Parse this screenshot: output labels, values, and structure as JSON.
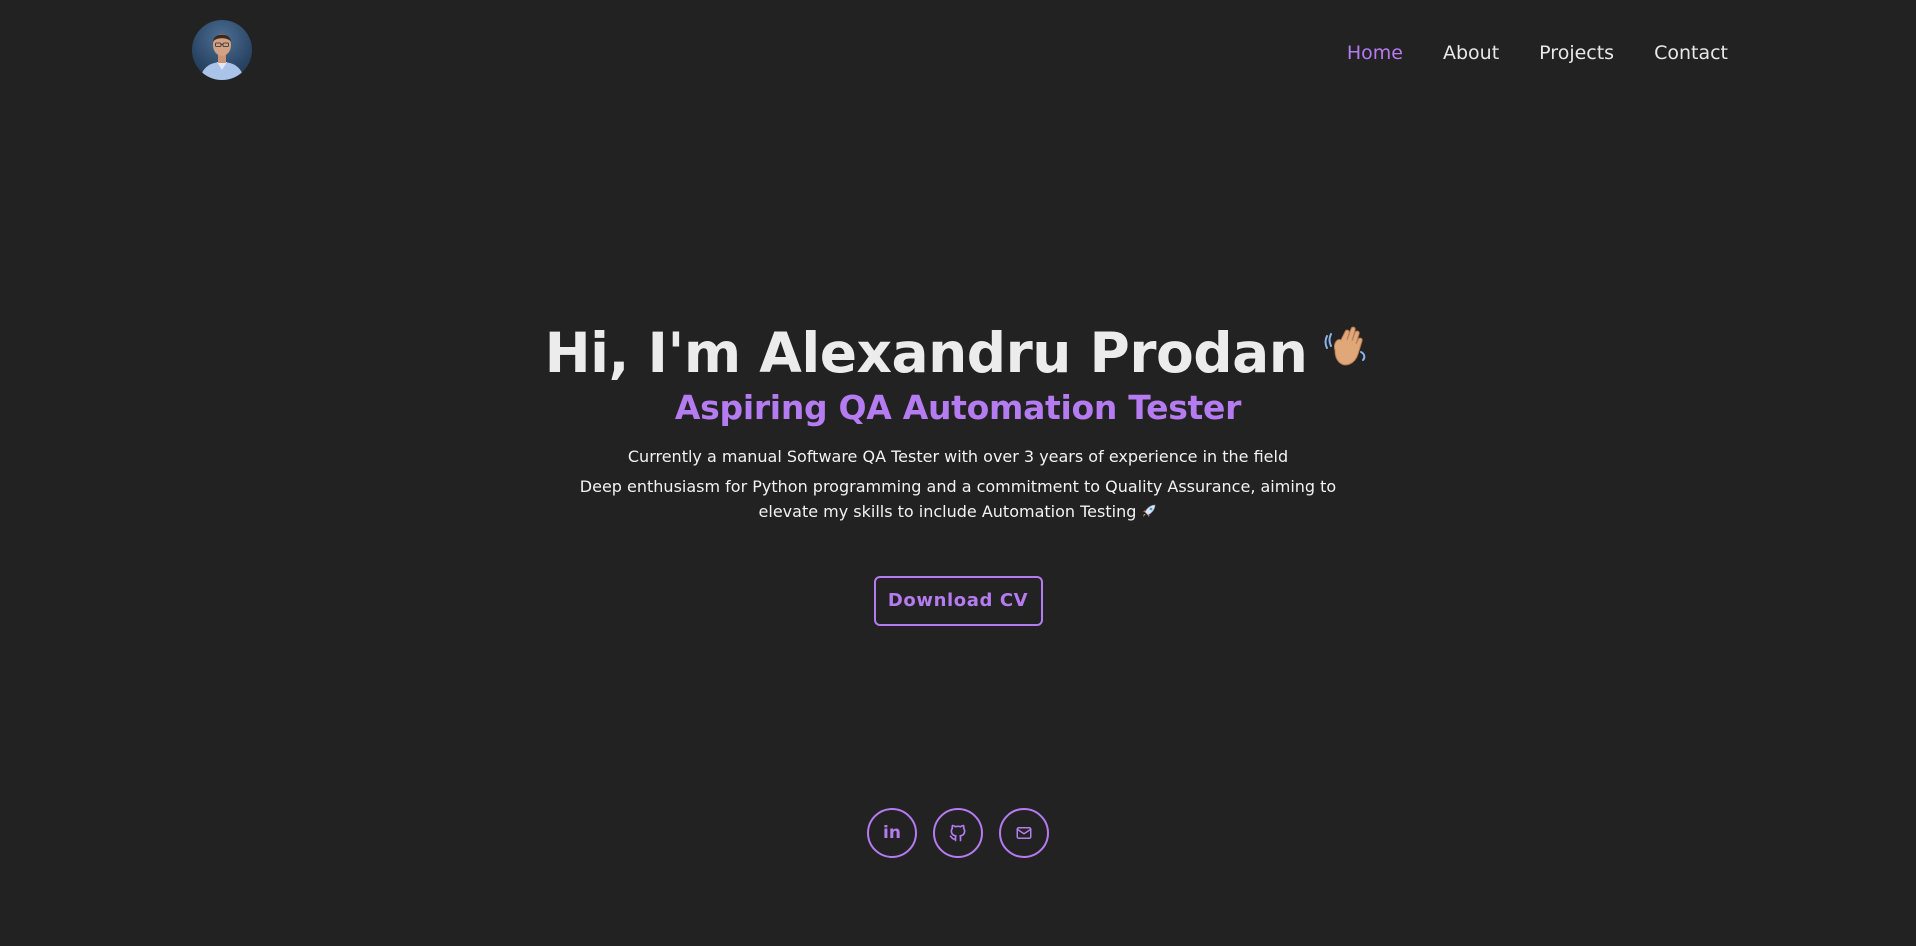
{
  "header": {
    "nav": [
      {
        "label": "Home"
      },
      {
        "label": "About"
      },
      {
        "label": "Projects"
      },
      {
        "label": "Contact"
      }
    ]
  },
  "hero": {
    "title": "Hi, I'm Alexandru Prodan",
    "subtitle": "Aspiring QA Automation Tester",
    "description_line1": "Currently a manual Software QA Tester with over 3 years of experience in the field",
    "description_line2": "Deep enthusiasm for Python programming and a commitment to Quality Assurance, aiming to elevate my skills to include Automation Testing",
    "cta_label": "Download CV"
  },
  "socials": {
    "linkedin_label": "in"
  },
  "colors": {
    "background": "#222222",
    "accent": "#b57bf0",
    "text": "#ececec"
  },
  "icons": [
    "avatar-photo",
    "waving-hand-icon",
    "rocket-icon",
    "linkedin-icon",
    "github-icon",
    "mail-icon"
  ]
}
